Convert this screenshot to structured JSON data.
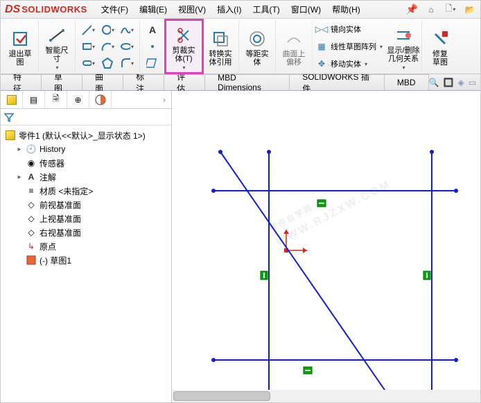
{
  "title": {
    "ds": "DS",
    "sw": "SOLIDWORKS"
  },
  "menu": [
    "文件(F)",
    "编辑(E)",
    "视图(V)",
    "插入(I)",
    "工具(T)",
    "窗口(W)",
    "帮助(H)"
  ],
  "ribbon": {
    "exit": "退出草\n图",
    "smart": "智能尺\n寸",
    "trim": "剪裁实\n体(T)",
    "convert": "转换实\n体引用",
    "offset": "等距实\n体",
    "surface": "曲面上\n偏移",
    "mirror": "镜向实体",
    "pattern": "线性草图阵列",
    "move": "移动实体",
    "display": "显示/删除\n几何关系",
    "repair": "修复\n草图"
  },
  "tabs": [
    "特征",
    "草图",
    "曲面",
    "标注",
    "评估",
    "MBD Dimensions",
    "SOLIDWORKS 插件",
    "MBD"
  ],
  "tree": {
    "root": "零件1  (默认<<默认>_显示状态 1>)",
    "items": [
      "History",
      "传感器",
      "注解",
      "材质 <未指定>",
      "前视基准面",
      "上视基准面",
      "右视基准面",
      "原点",
      "(-) 草图1"
    ]
  },
  "watermark": {
    "big": "软件自学网",
    "small": "WWW.RJZXW.COM"
  }
}
